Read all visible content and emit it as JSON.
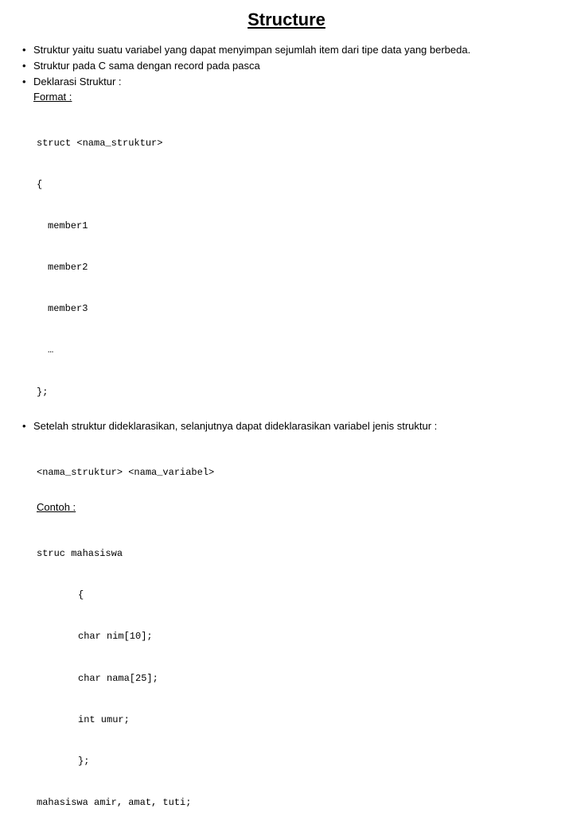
{
  "title": "Structure",
  "bullets1": [
    "Struktur yaitu suatu variabel yang dapat menyimpan sejumlah item dari tipe data yang berbeda.",
    "Struktur pada C sama dengan record pada pasca",
    "Deklarasi Struktur :"
  ],
  "format_label": "Format :",
  "code1": {
    "l1": "struct <nama_struktur>",
    "l2": "{",
    "l3": "member1",
    "l4": "member2",
    "l5": "member3",
    "l6": "…",
    "l7": "};"
  },
  "bullet2": "Setelah struktur dideklarasikan, selanjutnya dapat dideklarasikan variabel jenis struktur :",
  "code2": "<nama_struktur> <nama_variabel>",
  "contoh_label": "Contoh :",
  "code3": {
    "l1": "struc mahasiswa",
    "l2": "{",
    "l3": "char nim[10];",
    "l4": "char nama[25];",
    "l5": "int umur;",
    "l6": "};",
    "l7": "mahasiswa amir, amat, tuti;"
  }
}
